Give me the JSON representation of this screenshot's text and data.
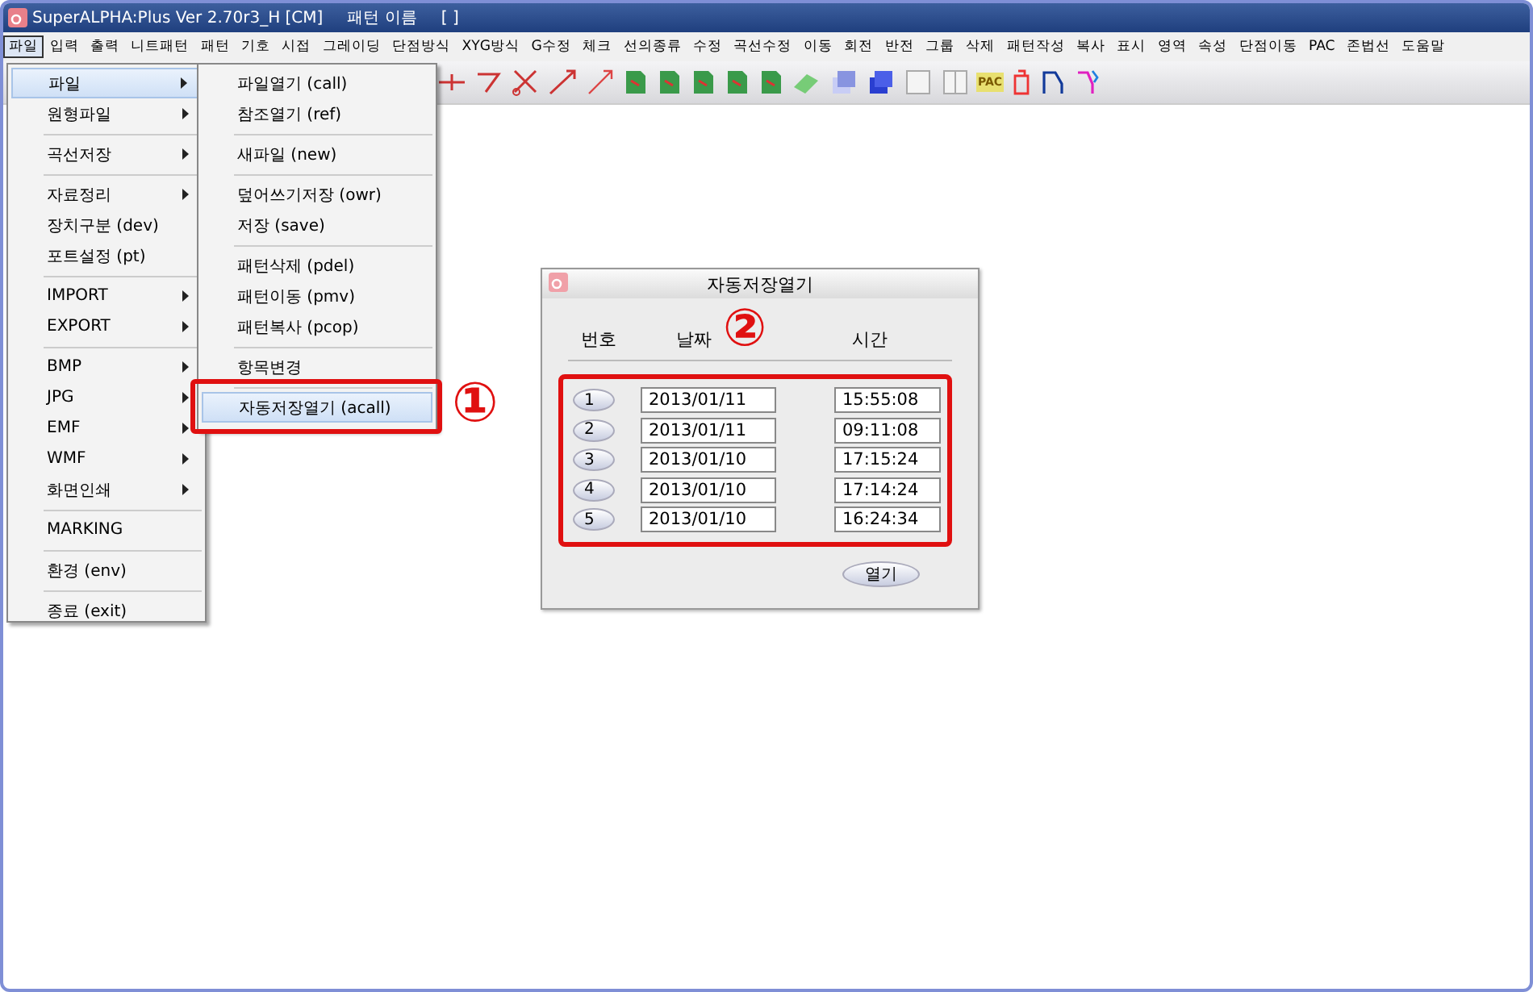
{
  "window": {
    "title": "SuperALPHA:Plus Ver 2.70r3_H [CM]",
    "pattern_label": "패턴 이름",
    "pattern_value": "[ ]"
  },
  "menubar": [
    {
      "label": "파일",
      "selected": true
    },
    {
      "label": "입력",
      "selected": false
    },
    {
      "label": "출력",
      "selected": false
    },
    {
      "label": "니트패턴",
      "selected": false
    },
    {
      "label": "패턴",
      "selected": false
    },
    {
      "label": "기호",
      "selected": false
    },
    {
      "label": "시접",
      "selected": false
    },
    {
      "label": "그레이딩",
      "selected": false
    },
    {
      "label": "단점방식",
      "selected": false
    },
    {
      "label": "XYG방식",
      "selected": false
    },
    {
      "label": "G수정",
      "selected": false
    },
    {
      "label": "체크",
      "selected": false
    },
    {
      "label": "선의종류",
      "selected": false
    },
    {
      "label": "수정",
      "selected": false
    },
    {
      "label": "곡선수정",
      "selected": false
    },
    {
      "label": "이동",
      "selected": false
    },
    {
      "label": "회전",
      "selected": false
    },
    {
      "label": "반전",
      "selected": false
    },
    {
      "label": "그룹",
      "selected": false
    },
    {
      "label": "삭제",
      "selected": false
    },
    {
      "label": "패턴작성",
      "selected": false
    },
    {
      "label": "복사",
      "selected": false
    },
    {
      "label": "표시",
      "selected": false
    },
    {
      "label": "영역",
      "selected": false
    },
    {
      "label": "속성",
      "selected": false
    },
    {
      "label": "단점이동",
      "selected": false
    },
    {
      "label": "PAC",
      "selected": false
    },
    {
      "label": "존법선",
      "selected": false
    },
    {
      "label": "도움말",
      "selected": false
    }
  ],
  "toolbar": {
    "pac_icon_label": "PAC"
  },
  "file_menu": [
    [
      {
        "label": "파일",
        "submenu": true,
        "selected": true
      },
      {
        "label": "원형파일",
        "submenu": true,
        "selected": false
      }
    ],
    [
      {
        "label": "곡선저장",
        "submenu": true,
        "selected": false
      }
    ],
    [
      {
        "label": "자료정리",
        "submenu": true,
        "selected": false
      },
      {
        "label": "장치구분 (dev)",
        "submenu": false,
        "selected": false
      },
      {
        "label": "포트설정 (pt)",
        "submenu": false,
        "selected": false
      }
    ],
    [
      {
        "label": "IMPORT",
        "submenu": true,
        "selected": false
      },
      {
        "label": "EXPORT",
        "submenu": true,
        "selected": false
      }
    ],
    [
      {
        "label": "BMP",
        "submenu": true,
        "selected": false
      },
      {
        "label": "JPG",
        "submenu": true,
        "selected": false
      },
      {
        "label": "EMF",
        "submenu": true,
        "selected": false
      },
      {
        "label": "WMF",
        "submenu": true,
        "selected": false
      },
      {
        "label": "화면인쇄",
        "submenu": true,
        "selected": false
      }
    ],
    [
      {
        "label": "MARKING",
        "submenu": false,
        "selected": false
      }
    ],
    [
      {
        "label": "환경 (env)",
        "submenu": false,
        "selected": false
      }
    ],
    [
      {
        "label": "종료 (exit)",
        "submenu": false,
        "selected": false
      }
    ]
  ],
  "file_submenu": [
    [
      {
        "label": "파일열기 (call)",
        "selected": false
      },
      {
        "label": "참조열기 (ref)",
        "selected": false
      }
    ],
    [
      {
        "label": "새파일 (new)",
        "selected": false
      }
    ],
    [
      {
        "label": "덮어쓰기저장 (owr)",
        "selected": false
      },
      {
        "label": "저장 (save)",
        "selected": false
      }
    ],
    [
      {
        "label": "패턴삭제 (pdel)",
        "selected": false
      },
      {
        "label": "패턴이동 (pmv)",
        "selected": false
      },
      {
        "label": "패턴복사 (pcop)",
        "selected": false
      }
    ],
    [
      {
        "label": "항목변경",
        "selected": false
      }
    ],
    [
      {
        "label": "자동저장열기 (acall)",
        "selected": true
      }
    ]
  ],
  "step_markers": [
    "①",
    "②"
  ],
  "dialog": {
    "title": "자동저장열기",
    "columns": [
      "번호",
      "날짜",
      "시간"
    ],
    "rows": [
      {
        "number": "1",
        "date": "2013/01/11",
        "time": "15:55:08"
      },
      {
        "number": "2",
        "date": "2013/01/11",
        "time": "09:11:08"
      },
      {
        "number": "3",
        "date": "2013/01/10",
        "time": "17:15:24"
      },
      {
        "number": "4",
        "date": "2013/01/10",
        "time": "17:14:24"
      },
      {
        "number": "5",
        "date": "2013/01/10",
        "time": "16:24:34"
      }
    ],
    "open_button": "열기"
  }
}
